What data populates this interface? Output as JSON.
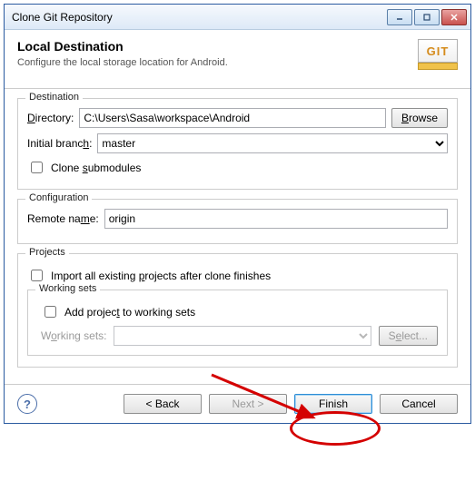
{
  "window": {
    "title": "Clone Git Repository"
  },
  "header": {
    "title": "Local Destination",
    "subtitle": "Configure the local storage location for Android.",
    "git_label": "GIT"
  },
  "destination": {
    "legend": "Destination",
    "directory_label_pre": "D",
    "directory_label_post": "irectory:",
    "directory_value": "C:\\Users\\Sasa\\workspace\\Android",
    "browse_label_pre": "B",
    "browse_label_post": "rowse",
    "initial_branch_label": "Initial branc",
    "initial_branch_label_u": "h",
    "initial_branch_label_post": ":",
    "initial_branch_value": "master",
    "clone_submodules_label": "Clone ",
    "clone_submodules_label_u": "s",
    "clone_submodules_label_post": "ubmodules"
  },
  "configuration": {
    "legend": "Configuration",
    "remote_name_label": "Remote na",
    "remote_name_label_u": "m",
    "remote_name_label_post": "e:",
    "remote_name_value": "origin"
  },
  "projects": {
    "legend": "Projects",
    "import_label_pre": "Import all existing ",
    "import_label_u": "p",
    "import_label_post": "rojects after clone finishes",
    "working_sets_legend": "Working sets",
    "add_to_ws_label": "Add projec",
    "add_to_ws_label_u": "t",
    "add_to_ws_label_post": " to working sets",
    "ws_label_pre": "W",
    "ws_label_u": "o",
    "ws_label_post": "rking sets:",
    "select_label": "S",
    "select_label_u": "e",
    "select_label_post": "lect..."
  },
  "footer": {
    "back_label": "< Back",
    "next_label": "Next >",
    "finish_label": "Finish",
    "cancel_label": "Cancel"
  }
}
